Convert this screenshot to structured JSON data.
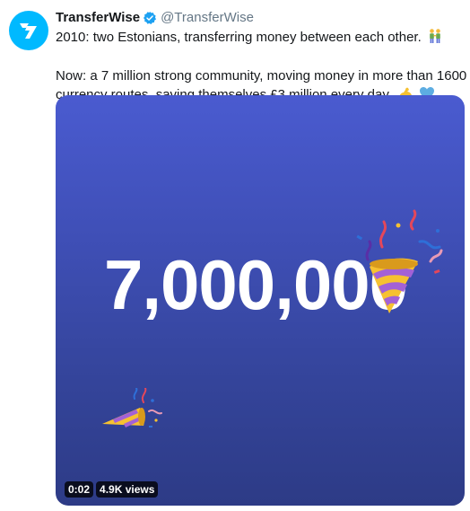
{
  "account": {
    "display_name": "TransferWise",
    "handle": "@TransferWise",
    "verified": true,
    "avatar_icon": "transferwise-logo-icon",
    "avatar_color": "#00b9ff"
  },
  "tweet": {
    "line1": "2010: two Estonians, transferring money between each other.",
    "line2": "Now:  a 7 million strong community, moving money in more than 1600",
    "line3": "currency routes, saving themselves £3 million every day."
  },
  "media": {
    "headline": "7,000,000",
    "elapsed": "0:02",
    "views": "4.9K views",
    "background_color": "#3f4fb6"
  },
  "colors": {
    "text": "#14171a",
    "secondary": "#657786",
    "verified_blue": "#1da1f2"
  }
}
